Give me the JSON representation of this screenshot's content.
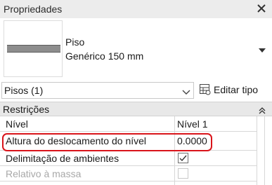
{
  "panel": {
    "title": "Propriedades"
  },
  "type_selector": {
    "family": "Piso",
    "type": "Genérico 150 mm"
  },
  "instance_filter": {
    "value": "Pisos (1)",
    "edit_type_label": "Editar tipo"
  },
  "category": {
    "label": "Restrições"
  },
  "properties": [
    {
      "name": "Nível",
      "value": "Nível 1",
      "enabled": true
    },
    {
      "name": "Altura do deslocamento do nível",
      "value": "0.0000",
      "enabled": true,
      "highlighted": true
    },
    {
      "name": "Delimitação de ambientes",
      "checked": true,
      "enabled": true
    },
    {
      "name": "Relativo à massa",
      "checked": false,
      "enabled": false
    }
  ],
  "colors": {
    "highlight": "#d9141a",
    "disabled_text": "#a8a8a8",
    "header_bg": "#e8e8e8"
  }
}
